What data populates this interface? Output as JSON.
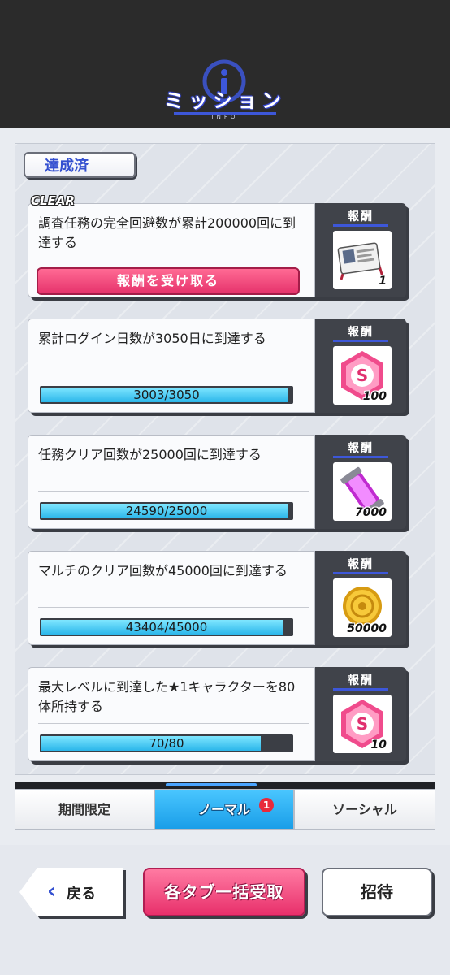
{
  "header": {
    "title": "ミッション",
    "subtitle": "INFO"
  },
  "section": {
    "completed_label": "達成済"
  },
  "missions": [
    {
      "text": "調査任務の完全回避数が累計200000回に到達する",
      "status": "CLEAR",
      "claim_label": "報酬を受け取る",
      "reward": {
        "label": "報酬",
        "icon": "id-card-icon",
        "count": "1"
      }
    },
    {
      "text": "累計ログイン日数が3050日に到達する",
      "progress_text": "3003/3050",
      "progress": 0.985,
      "reward": {
        "label": "報酬",
        "icon": "s-gem-icon",
        "count": "100"
      }
    },
    {
      "text": "任務クリア回数が25000回に到達する",
      "progress_text": "24590/25000",
      "progress": 0.984,
      "reward": {
        "label": "報酬",
        "icon": "energy-capsule-icon",
        "count": "7000"
      }
    },
    {
      "text": "マルチのクリア回数が45000回に到達する",
      "progress_text": "43404/45000",
      "progress": 0.964,
      "reward": {
        "label": "報酬",
        "icon": "gold-coin-icon",
        "count": "50000"
      }
    },
    {
      "text": "最大レベルに到達した★1キャラクターを80体所持する",
      "progress_text": "70/80",
      "progress": 0.875,
      "reward": {
        "label": "報酬",
        "icon": "s-gem-icon",
        "count": "10"
      }
    }
  ],
  "tabs": [
    {
      "label": "期間限定",
      "active": false
    },
    {
      "label": "ノーマル",
      "active": true,
      "badge": "1"
    },
    {
      "label": "ソーシャル",
      "active": false
    }
  ],
  "buttons": {
    "back": "戻る",
    "bulk_claim": "各タブ一括受取",
    "invite": "招待"
  },
  "colors": {
    "accent_blue": "#3d57d9",
    "claim_pink": "#e6336c",
    "progress_cyan": "#2bb6ea",
    "header_dark": "#2b2b2b"
  }
}
